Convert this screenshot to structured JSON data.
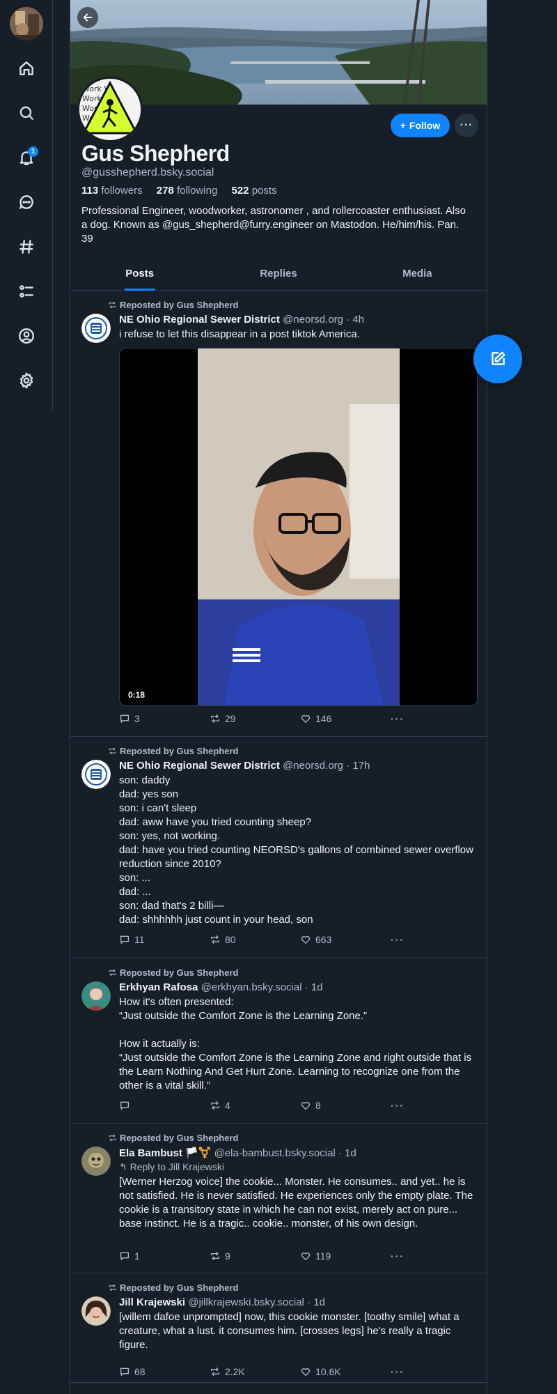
{
  "nav": {
    "notification_count": "1"
  },
  "profile": {
    "display_name": "Gus Shepherd",
    "handle": "@gusshepherd.bsky.social",
    "followers_count": "113",
    "followers_label": "followers",
    "following_count": "278",
    "following_label": "following",
    "posts_count": "522",
    "posts_label": "posts",
    "bio": "Professional Engineer, woodworker, astronomer , and rollercoaster enthusiast. Also a dog. Known as  @gus_shepherd@furry.engineer on Mastodon. He/him/his. Pan. 39",
    "follow_label": "Follow"
  },
  "tabs": [
    "Posts",
    "Replies",
    "Media"
  ],
  "posts": [
    {
      "repost_label": "Reposted by Gus Shepherd",
      "author": "NE Ohio Regional Sewer District",
      "handle": "@neorsd.org",
      "time": "· 4h",
      "text": "i refuse to let this disappear in a post tiktok America.",
      "video_duration": "0:18",
      "replies": "3",
      "reposts": "29",
      "likes": "146"
    },
    {
      "repost_label": "Reposted by Gus Shepherd",
      "author": "NE Ohio Regional Sewer District",
      "handle": "@neorsd.org",
      "time": "· 17h",
      "text": "son: daddy\ndad: yes son\nson: i can't sleep\ndad: aww have you tried counting sheep?\nson: yes, not working.\ndad: have you tried counting NEORSD's gallons of combined sewer overflow reduction since 2010?\nson: ...\ndad: ...\nson: dad that's 2 billi—\ndad: shhhhhh just count in your head, son",
      "replies": "11",
      "reposts": "80",
      "likes": "663"
    },
    {
      "repost_label": "Reposted by Gus Shepherd",
      "author": "Erkhyan Rafosa",
      "handle": "@erkhyan.bsky.social",
      "time": "· 1d",
      "text": "How it's often presented:\n“Just outside the Comfort Zone is the Learning Zone.”\n\nHow it actually is:\n“Just outside the Comfort Zone is the Learning Zone and right outside that is the Learn Nothing And Get Hurt Zone. Learning to recognize one from the other is a vital skill.”",
      "replies": "",
      "reposts": "4",
      "likes": "8"
    },
    {
      "repost_label": "Reposted by Gus Shepherd",
      "author": "Ela Bambust 🏳️⚧️",
      "handle": "@ela-bambust.bsky.social",
      "time": "· 1d",
      "reply_to": "Reply to Jill Krajewski",
      "text": "[Werner Herzog voice] the cookie... Monster. He consumes.. and yet.. he is not satisfied. He is never satisfied. He experiences only the empty plate. The cookie is a transitory state in which he can not exist, merely act on pure... base instinct. He is a tragic.. cookie.. monster, of his own design.",
      "replies": "1",
      "reposts": "9",
      "likes": "119"
    },
    {
      "repost_label": "Reposted by Gus Shepherd",
      "author": "Jill Krajewski",
      "handle": "@jillkrajewski.bsky.social",
      "time": "· 1d",
      "text": "[willem dafoe unprompted] now, this cookie monster. [toothy smile] what a creature, what a lust. it consumes him. [crosses legs] he's really a tragic figure.",
      "replies": "68",
      "reposts": "2.2K",
      "likes": "10.6K"
    }
  ]
}
